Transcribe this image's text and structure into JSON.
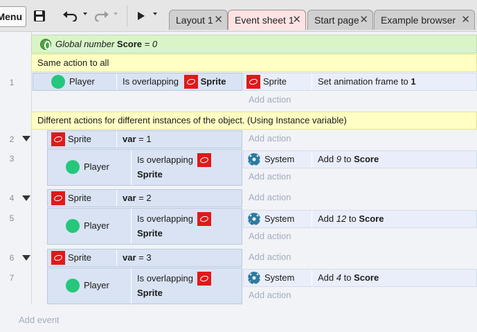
{
  "toolbar": {
    "menu_label": "Menu",
    "icons": [
      "save-icon",
      "undo-icon",
      "redo-icon",
      "play-icon"
    ]
  },
  "tabs": [
    {
      "label": "Layout 1",
      "close": "✕"
    },
    {
      "label": "Event sheet 1",
      "close": "✕"
    },
    {
      "label": "Start page",
      "close": "✕"
    },
    {
      "label": "Example browser",
      "close": "✕"
    }
  ],
  "sheet": {
    "global": {
      "prefix": "Global number",
      "name": "Score",
      "rest": "= 0"
    },
    "comment1": "Same action to all",
    "comment2": "Different actions for different instances of the object. (Using Instance variable)",
    "add_action": "Add action",
    "add_event": "Add event",
    "events": [
      {
        "num": "1",
        "obj": "Player",
        "cond_text": "Is overlapping",
        "cond_obj": "Sprite",
        "act_obj": "Sprite",
        "act_text": "Set animation frame to",
        "act_value": "1"
      },
      {
        "num": "2",
        "obj": "Sprite",
        "var": "var",
        "var_rest": "= 1"
      },
      {
        "num": "3",
        "obj": "Player",
        "cond_text": "Is overlapping",
        "cond_obj": "Sprite",
        "act_obj": "System",
        "act_pre": "Add",
        "act_num": "9",
        "act_mid": "to",
        "act_target": "Score"
      },
      {
        "num": "4",
        "obj": "Sprite",
        "var": "var",
        "var_rest": "= 2"
      },
      {
        "num": "5",
        "obj": "Player",
        "cond_text": "Is overlapping",
        "cond_obj": "Sprite",
        "act_obj": "System",
        "act_pre": "Add",
        "act_num": "12",
        "act_mid": "to",
        "act_target": "Score"
      },
      {
        "num": "6",
        "obj": "Sprite",
        "var": "var",
        "var_rest": "= 3"
      },
      {
        "num": "7",
        "obj": "Player",
        "cond_text": "Is overlapping",
        "cond_obj": "Sprite",
        "act_obj": "System",
        "act_pre": "Add",
        "act_num": "4",
        "act_mid": "to",
        "act_target": "Score"
      }
    ]
  }
}
